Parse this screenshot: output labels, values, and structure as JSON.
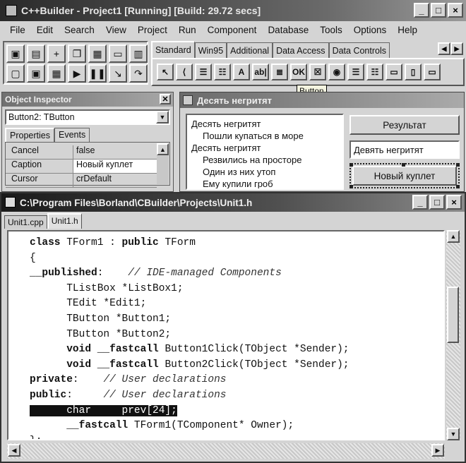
{
  "main_window": {
    "title": "C++Builder - Project1 [Running] [Build: 29.72 secs]",
    "controls": [
      "_",
      "□",
      "×"
    ]
  },
  "menu": [
    "File",
    "Edit",
    "Search",
    "View",
    "Project",
    "Run",
    "Component",
    "Database",
    "Tools",
    "Options",
    "Help"
  ],
  "speedbar_icons": [
    "open-project-icon",
    "save-project-icon",
    "add-file-icon",
    "open-file-icon",
    "save-file-icon",
    "remove-file-icon",
    "select-unit-icon",
    "select-form-icon",
    "toggle-form-unit-icon",
    "new-form-icon",
    "run-icon",
    "pause-icon",
    "trace-into-icon",
    "step-over-icon"
  ],
  "palette": {
    "tabs": [
      "Standard",
      "Win95",
      "Additional",
      "Data Access",
      "Data Controls"
    ],
    "active_tab": "Standard",
    "icons": [
      "pointer",
      "frames",
      "main-menu",
      "popup-menu",
      "label",
      "edit",
      "memo",
      "button",
      "checkbox",
      "radiobutton",
      "listbox",
      "combobox",
      "scrollbar",
      "groupbox",
      "panel"
    ],
    "icon_glyphs": [
      "↖",
      "⟨",
      "☰",
      "☷",
      "A",
      "ab|",
      "≣",
      "OK",
      "☒",
      "◉",
      "☰",
      "☷",
      "▭",
      "▯",
      "▭"
    ],
    "tooltip": "Button"
  },
  "inspector": {
    "title": "Object Inspector",
    "selected_component": "Button2: TButton",
    "tabs": [
      "Properties",
      "Events"
    ],
    "properties": [
      {
        "name": "Cancel",
        "value": "false"
      },
      {
        "name": "Caption",
        "value": "Новый куплет"
      },
      {
        "name": "Cursor",
        "value": "crDefault"
      }
    ]
  },
  "form": {
    "title": "Десять негритят",
    "listbox_lines": [
      {
        "text": "Десять негритят",
        "indent": false
      },
      {
        "text": "Пошли купаться в море",
        "indent": true
      },
      {
        "text": "Десять негритят",
        "indent": false
      },
      {
        "text": "Резвились на просторе",
        "indent": true
      },
      {
        "text": "Один из них утоп",
        "indent": true
      },
      {
        "text": "Ему купили гроб",
        "indent": true
      }
    ],
    "result_button": "Результат",
    "edit_value": "Девять негритят",
    "new_verse_button": "Новый куплет"
  },
  "editor": {
    "title": "C:\\Program Files\\Borland\\CBuilder\\Projects\\Unit1.h",
    "tabs": [
      "Unit1.cpp",
      "Unit1.h"
    ],
    "active_tab": "Unit1.h",
    "lines": [
      [
        {
          "t": "class",
          "c": "kw"
        },
        {
          "t": " TForm1 : "
        },
        {
          "t": "public",
          "c": "kw"
        },
        {
          "t": " TForm"
        }
      ],
      [
        {
          "t": "{"
        }
      ],
      [
        {
          "t": "__published",
          "c": "kw"
        },
        {
          "t": ":    "
        },
        {
          "t": "// IDE-managed Components",
          "c": "cm"
        }
      ],
      [
        {
          "t": "      TListBox *ListBox1;"
        }
      ],
      [
        {
          "t": "      TEdit *Edit1;"
        }
      ],
      [
        {
          "t": "      TButton *Button1;"
        }
      ],
      [
        {
          "t": "      TButton *Button2;"
        }
      ],
      [
        {
          "t": "      "
        },
        {
          "t": "void",
          "c": "kw"
        },
        {
          "t": " "
        },
        {
          "t": "__fastcall",
          "c": "kw"
        },
        {
          "t": " Button1Click(TObject *Sender);"
        }
      ],
      [
        {
          "t": "      "
        },
        {
          "t": "void",
          "c": "kw"
        },
        {
          "t": " "
        },
        {
          "t": "__fastcall",
          "c": "kw"
        },
        {
          "t": " Button2Click(TObject *Sender);"
        }
      ],
      [
        {
          "t": "private",
          "c": "kw"
        },
        {
          "t": ":    "
        },
        {
          "t": "// User declarations",
          "c": "cm"
        }
      ],
      [
        {
          "t": "public",
          "c": "kw"
        },
        {
          "t": ":     "
        },
        {
          "t": "// User declarations",
          "c": "cm"
        }
      ],
      [
        {
          "t": "      char     prev[24];",
          "c": "hl"
        }
      ],
      [
        {
          "t": "      "
        },
        {
          "t": "__fastcall",
          "c": "kw"
        },
        {
          "t": " TForm1(TComponent* Owner);"
        }
      ],
      [
        {
          "t": "};"
        }
      ]
    ]
  }
}
